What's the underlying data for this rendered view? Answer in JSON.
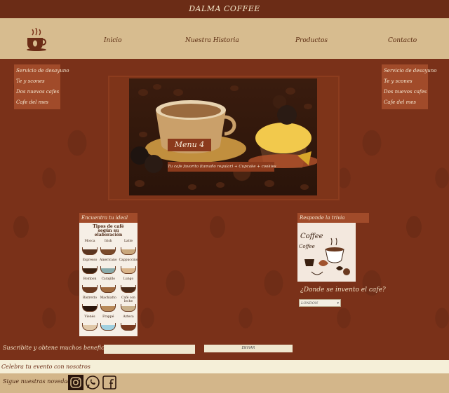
{
  "header": {
    "title": "DALMA COFFEE"
  },
  "nav": [
    "Inicio",
    "Nuestra Historia",
    "Productos",
    "Contacto"
  ],
  "side_menu_left": [
    "Servicio de desayuno",
    "Te y scones",
    "Dos nuevos cafes",
    "Cafe del mes"
  ],
  "side_menu_right": [
    "Servicio de desayuno",
    "Te y scones",
    "Dos nuevos cafes",
    "Cafe del mes"
  ],
  "hero": {
    "caption": "Menu 4",
    "subcaption": "Tu cafe favorito (tamaño regular) + Cupcake + cookies"
  },
  "left_panel": {
    "title": "Encuentra tu ideal",
    "infographic_title": "Tipos de café según su elaboración",
    "coffee_types": [
      "Mocca",
      "Irish",
      "Latte",
      "Espresso",
      "Americano",
      "Cappuccino",
      "Bombon",
      "Carajillo",
      "Lungo",
      "Ristretto",
      "Machiatto",
      "Café con leche",
      "Vienés",
      "Frappé",
      "Azteca"
    ]
  },
  "right_panel": {
    "title": "Responde la trivia",
    "image_word": "Coffee",
    "question": "¿Donde se invento el cafe?",
    "select_value": "LONDON"
  },
  "subscribe": {
    "text": "Suscribite y obtene muchos beneficios",
    "button": "ENVIAR"
  },
  "event": {
    "text": "Celebra tu evento con nosotros"
  },
  "footer": {
    "text": "Sigue nuestras novedades"
  },
  "colors": {
    "brand_dark": "#6b2c16",
    "accent": "#a14b2a",
    "cream": "#d7bc8f"
  }
}
